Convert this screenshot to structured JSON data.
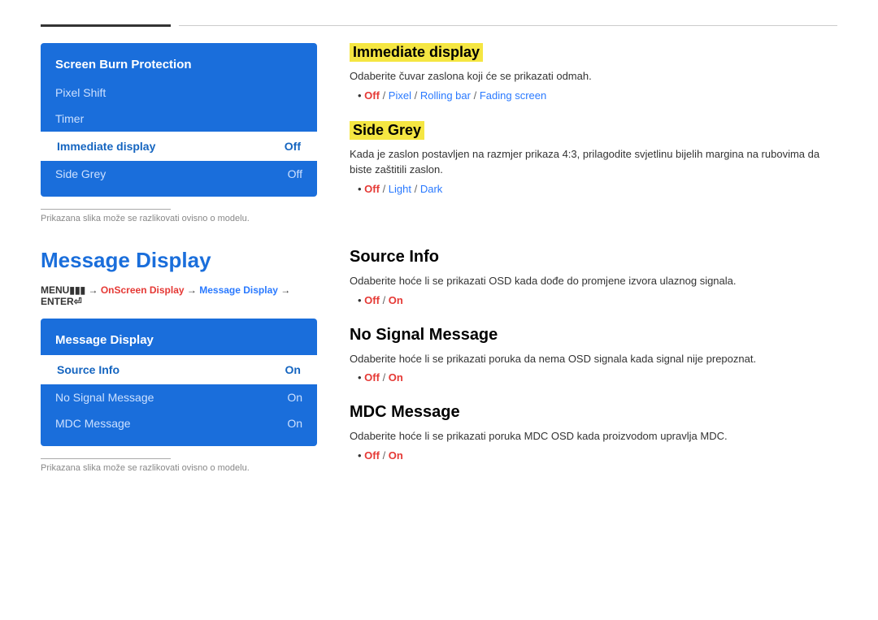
{
  "topDivider": true,
  "section1": {
    "menu": {
      "title": "Screen Burn Protection",
      "items": [
        {
          "label": "Pixel Shift",
          "value": "",
          "active": false
        },
        {
          "label": "Timer",
          "value": "",
          "active": false
        },
        {
          "label": "Immediate display",
          "value": "Off",
          "active": true
        },
        {
          "label": "Side Grey",
          "value": "Off",
          "active": false
        }
      ]
    },
    "note": "Prikazana slika može se razlikovati ovisno o modelu.",
    "right": {
      "blocks": [
        {
          "heading": "Immediate display",
          "highlight": true,
          "desc": "Odaberite čuvar zaslona koji će se prikazati odmah.",
          "options": [
            {
              "text": "Off",
              "type": "off"
            },
            {
              "text": " / ",
              "type": "sep"
            },
            {
              "text": "Pixel",
              "type": "other"
            },
            {
              "text": " / ",
              "type": "sep"
            },
            {
              "text": "Rolling bar",
              "type": "other"
            },
            {
              "text": " / ",
              "type": "sep"
            },
            {
              "text": "Fading screen",
              "type": "fading"
            }
          ]
        },
        {
          "heading": "Side Grey",
          "highlight": true,
          "desc": "Kada je zaslon postavljen na razmjer prikaza 4:3, prilagodite svjetlinu bijelih margina na rubovima da biste zaštitili zaslon.",
          "options": [
            {
              "text": "Off",
              "type": "off"
            },
            {
              "text": " / ",
              "type": "sep"
            },
            {
              "text": "Light",
              "type": "other"
            },
            {
              "text": " / ",
              "type": "sep"
            },
            {
              "text": "Dark",
              "type": "dark"
            }
          ]
        }
      ]
    }
  },
  "section2": {
    "pageTitle": "Message Display",
    "breadcrumb": {
      "parts": [
        {
          "text": "MENU",
          "type": "normal"
        },
        {
          "text": "III",
          "type": "normal"
        },
        {
          "text": " → ",
          "type": "normal"
        },
        {
          "text": "OnScreen Display",
          "type": "highlight"
        },
        {
          "text": " → ",
          "type": "normal"
        },
        {
          "text": "Message Display",
          "type": "blue"
        },
        {
          "text": " → ENTER",
          "type": "normal"
        },
        {
          "text": "↵",
          "type": "normal"
        }
      ]
    },
    "menu": {
      "title": "Message Display",
      "items": [
        {
          "label": "Source Info",
          "value": "On",
          "active": true
        },
        {
          "label": "No Signal Message",
          "value": "On",
          "active": false
        },
        {
          "label": "MDC Message",
          "value": "On",
          "active": false
        }
      ]
    },
    "note": "Prikazana slika može se razlikovati ovisno o modelu.",
    "right": {
      "blocks": [
        {
          "heading": "Source Info",
          "highlight": false,
          "desc": "Odaberite hoće li se prikazati OSD kada dođe do promjene izvora ulaznog signala.",
          "options": [
            {
              "text": "Off",
              "type": "off"
            },
            {
              "text": " / ",
              "type": "sep"
            },
            {
              "text": "On",
              "type": "on"
            }
          ]
        },
        {
          "heading": "No Signal Message",
          "highlight": false,
          "desc": "Odaberite hoće li se prikazati poruka da nema OSD signala kada signal nije prepoznat.",
          "options": [
            {
              "text": "Off",
              "type": "off"
            },
            {
              "text": " / ",
              "type": "sep"
            },
            {
              "text": "On",
              "type": "on"
            }
          ]
        },
        {
          "heading": "MDC Message",
          "highlight": false,
          "desc": "Odaberite hoće li se prikazati poruka MDC OSD kada proizvodom upravlja MDC.",
          "options": [
            {
              "text": "Off",
              "type": "off"
            },
            {
              "text": " / ",
              "type": "sep"
            },
            {
              "text": "On",
              "type": "on"
            }
          ]
        }
      ]
    }
  }
}
